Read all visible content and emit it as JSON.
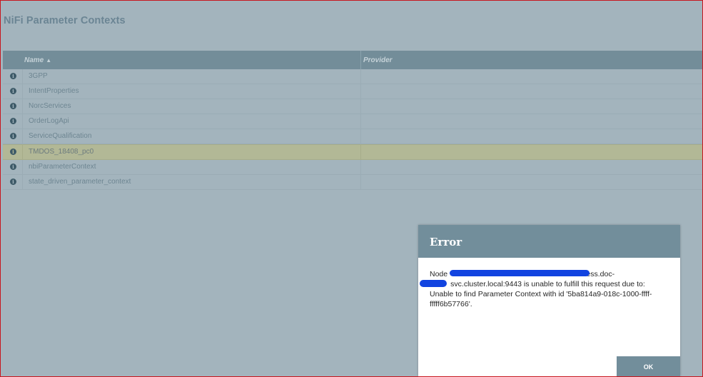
{
  "page": {
    "title": "NiFi Parameter Contexts"
  },
  "table": {
    "columns": {
      "name": "Name",
      "name_sort": "▲",
      "provider": "Provider"
    },
    "rows": [
      {
        "name": "3GPP",
        "provider": ""
      },
      {
        "name": "IntentProperties",
        "provider": ""
      },
      {
        "name": "NorcServices",
        "provider": ""
      },
      {
        "name": "OrderLogApi",
        "provider": ""
      },
      {
        "name": "ServiceQualification",
        "provider": ""
      },
      {
        "name": "TMDOS_18408_pc0",
        "provider": "",
        "highlighted": true
      },
      {
        "name": "nbiParameterContext",
        "provider": ""
      },
      {
        "name": "state_driven_parameter_context",
        "provider": ""
      }
    ]
  },
  "dialog": {
    "title": "Error",
    "message_lines": [
      "Node                                                    nifi-headless.doc-",
      "          svc.cluster.local:9443 is unable to fulfill this request due to:",
      "Unable to find Parameter Context with id '5ba814a9-018c-1000-ffff-",
      "fffff6b57766'."
    ],
    "ok_label": "OK",
    "redaction_color": "#1244e0"
  },
  "icons": {
    "row_info": "info-icon"
  },
  "colors": {
    "background": "#a3b4bd",
    "header": "#738d99",
    "highlight_row": "#b2b896",
    "dialog_header": "#728e9b"
  }
}
